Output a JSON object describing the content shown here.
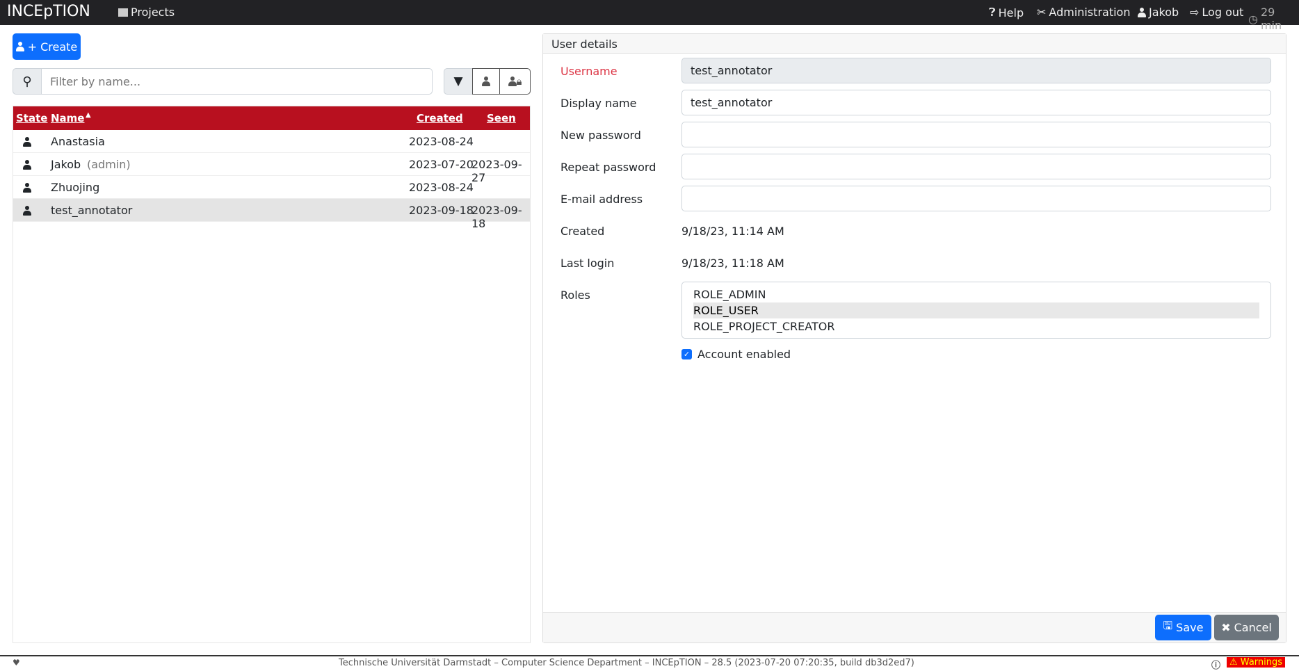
{
  "nav": {
    "brand": "INCEpTION",
    "projects": "Projects",
    "help": "Help",
    "administration": "Administration",
    "user": "Jakob",
    "logout": "Log out",
    "session": "29 min"
  },
  "left": {
    "create_label": "Create",
    "filter_placeholder": "Filter by name...",
    "columns": {
      "state": "State",
      "name": "Name",
      "created": "Created",
      "seen": "Seen"
    },
    "rows": [
      {
        "name": "Anastasia",
        "tag": "",
        "created": "2023-08-24",
        "seen": ""
      },
      {
        "name": "Jakob",
        "tag": "(admin)",
        "created": "2023-07-20",
        "seen": "2023-09-27"
      },
      {
        "name": "Zhuojing",
        "tag": "",
        "created": "2023-08-24",
        "seen": ""
      },
      {
        "name": "test_annotator",
        "tag": "",
        "created": "2023-09-18",
        "seen": "2023-09-18"
      }
    ]
  },
  "details": {
    "title": "User details",
    "username_label": "Username",
    "username": "test_annotator",
    "display_label": "Display name",
    "display": "test_annotator",
    "newpw_label": "New password",
    "repeatpw_label": "Repeat password",
    "email_label": "E-mail address",
    "created_label": "Created",
    "created": "9/18/23, 11:14 AM",
    "lastlogin_label": "Last login",
    "lastlogin": "9/18/23, 11:18 AM",
    "roles_label": "Roles",
    "roles": [
      "ROLE_ADMIN",
      "ROLE_USER",
      "ROLE_PROJECT_CREATOR"
    ],
    "enabled_label": "Account enabled",
    "save": "Save",
    "cancel": "Cancel"
  },
  "footer": {
    "text": "Technische Universität Darmstadt – Computer Science Department – INCEpTION – 28.5 (2023-07-20 07:20:35, build db3d2ed7)",
    "warnings": "Warnings"
  }
}
